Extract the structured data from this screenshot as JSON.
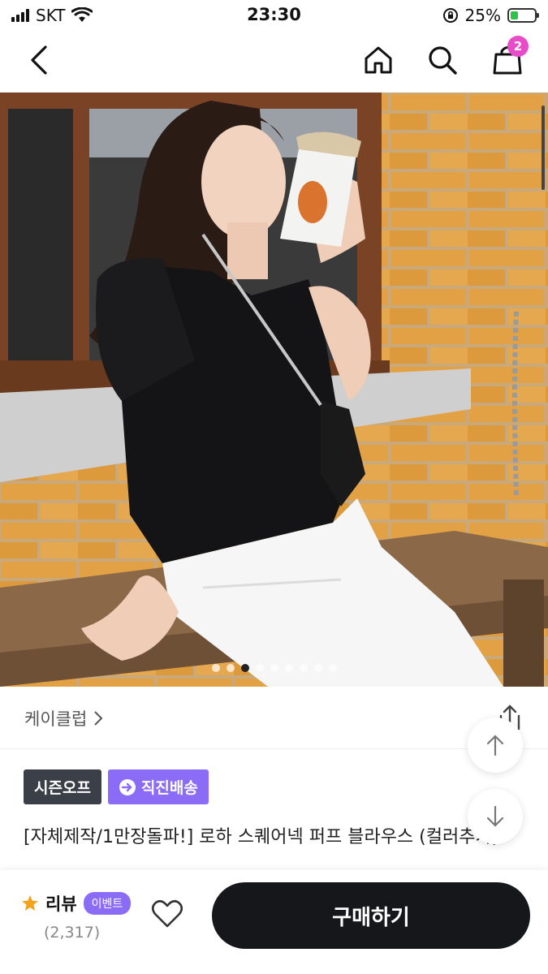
{
  "status": {
    "carrier": "SKT",
    "time": "23:30",
    "battery": "25%"
  },
  "header": {
    "cart_count": "2"
  },
  "hero": {
    "slide_count": 9,
    "active_index": 2
  },
  "brand": {
    "name": "케이클럽"
  },
  "badges": [
    {
      "label": "시즌오프",
      "color": "#3a3f48"
    },
    {
      "label": "직진배송",
      "color": "#8b6cf6"
    }
  ],
  "product": {
    "title": "[자체제작/1만장돌파!] 로하 스퀘어넥 퍼프 블라우스 (컬러추가)"
  },
  "review": {
    "label": "리뷰",
    "event": "이벤트",
    "count": "(2,317)"
  },
  "buy_label": "구매하기"
}
